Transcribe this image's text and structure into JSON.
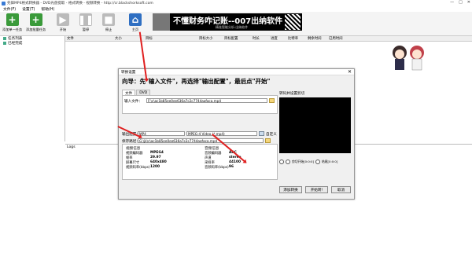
{
  "window": {
    "title": "先锋MP4格式转换器 - DVD光盘提取 - 格式转换 - 视频转换 - http://cr.blackshorksoft.com",
    "controls": [
      "—",
      "□",
      "✕"
    ]
  },
  "menu": [
    "文件(F)",
    "设置(T)",
    "帮助(H)"
  ],
  "toolbar": {
    "add_task": "添加单一任务",
    "add_batch": "添加批量任务",
    "start": "开始",
    "pause": "暂停",
    "stop": "停止",
    "home": "主页"
  },
  "banner": {
    "text": "不懂财务咋记账--007出纳软件",
    "sub": "精准智能分析·出纳软件"
  },
  "tree": {
    "items": [
      "任务列表",
      "已经完成"
    ]
  },
  "file_columns": [
    "文件",
    "大小",
    "目标",
    "目标大小",
    "目标配置",
    "时长",
    "进度",
    "比特率",
    "剩余时间",
    "已用时间"
  ],
  "logs_label": "Logs",
  "dialog": {
    "title": "转换设置",
    "instruction": "向导：先\"输入文件\"，再选择\"输出配置\"，最后点\"开始\"",
    "tabs": [
      "文件",
      "DVD"
    ],
    "input_label": "输入文件：",
    "input_value": "F:\\c\\ac1b85ee0ee636a7c2c7744aafaca.mp4",
    "output_profile_label": "输出配置：",
    "output_format": "MP4",
    "output_preset": "MPEG-4 Video (*.mp4)",
    "custom_label": "自定义",
    "save_path_label": "保存路径：",
    "save_path_value": "G:\\jk\\c\\ac1b85ee0ee636a7c2c7744aafaca.mp4",
    "preview_label": "转码并设置剪切",
    "video_info": {
      "title": "视频信息",
      "rows": [
        {
          "k": "视频编码器",
          "v": "MPEG4"
        },
        {
          "k": "帧率",
          "v": "29.97"
        },
        {
          "k": "屏幕尺寸",
          "v": "640x480"
        },
        {
          "k": "视频码率(kbps)",
          "v": "1200"
        }
      ]
    },
    "audio_info": {
      "title": "音频信息",
      "rows": [
        {
          "k": "音频编码器",
          "v": "AAC"
        },
        {
          "k": "声道",
          "v": "stereo"
        },
        {
          "k": "采样率",
          "v": "44100"
        },
        {
          "k": "音频码率(kbps)",
          "v": "96"
        }
      ]
    },
    "start_cut_label": "剪切开始[0:0:0]",
    "end_cut_label": "结尾[0:0:0]",
    "buttons": {
      "add_task": "添加转换",
      "start": "开始转!",
      "cancel": "取消"
    }
  },
  "colors": {
    "accent_red": "#e02020",
    "toolbar_bg": "#f4f4f4",
    "dialog_bg": "#f0f0f0"
  }
}
